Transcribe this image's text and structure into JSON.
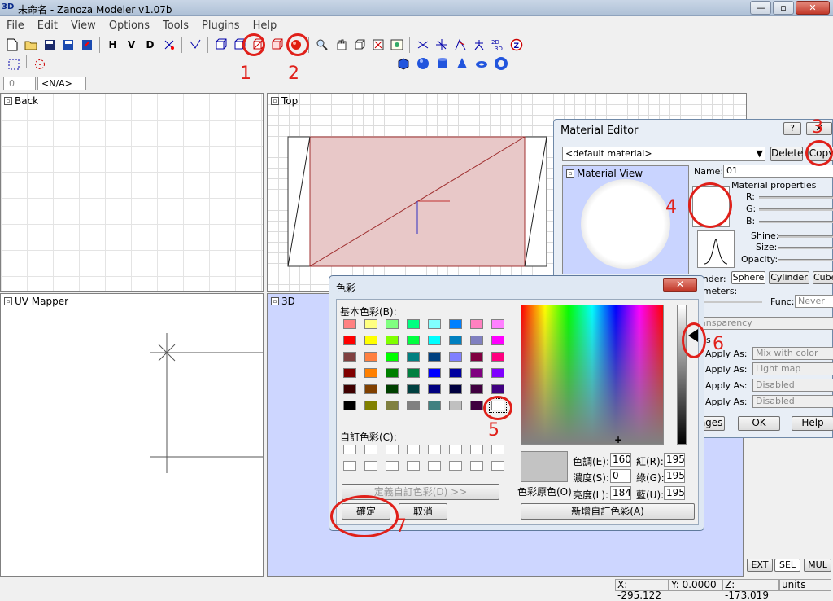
{
  "window": {
    "app_icon": "3D",
    "title": "未命名 - Zanoza Modeler v1.07b",
    "minimize": "—",
    "maximize": "▫",
    "close": "✕"
  },
  "menu": [
    "File",
    "Edit",
    "View",
    "Options",
    "Tools",
    "Plugins",
    "Help"
  ],
  "toolbar": {
    "h_label": "H",
    "v_label": "V",
    "d_label": "D"
  },
  "frame": {
    "value": "0",
    "na": "<N/A>"
  },
  "viewports": {
    "back": "Back",
    "top": "Top",
    "uv": "UV Mapper",
    "three_d": "3D"
  },
  "annotations": [
    "1",
    "2",
    "3",
    "4",
    "5",
    "6",
    "7"
  ],
  "material_editor": {
    "title": "Material Editor",
    "help": "?",
    "close": "✕",
    "material_select": "<default material>",
    "delete": "Delete",
    "copy": "Copy",
    "view_label": "Material View",
    "name_label": "Name:",
    "name_value": "01",
    "props_label": "Material properties",
    "r": "R:",
    "g": "G:",
    "b": "B:",
    "shine": "Shine:",
    "size": "Size:",
    "opacity": "Opacity:",
    "render_label": "ender:",
    "sphere": "Sphere",
    "cylinder": "Cylinder",
    "cube": "Cube",
    "parameters": "ameters:",
    "func": "Func:",
    "func_value": "Never",
    "transparency": "ansparency",
    "textures": "res",
    "apply_as": "Apply As:",
    "apply_values": [
      "Mix with color",
      "Light map",
      "Disabled",
      "Disabled"
    ],
    "changes": "nges",
    "ok": "OK",
    "help_btn": "Help"
  },
  "color_dialog": {
    "title": "色彩",
    "close": "✕",
    "basic_colors": "基本色彩(B):",
    "custom_colors": "自訂色彩(C):",
    "define_custom": "定義自訂色彩(D) >>",
    "ok": "確定",
    "cancel": "取消",
    "solid": "色彩原色(O)",
    "hue": "色調(E):",
    "hue_v": "160",
    "sat": "濃度(S):",
    "sat_v": "0",
    "lum": "亮度(L):",
    "lum_v": "184",
    "red": "紅(R):",
    "red_v": "195",
    "green": "綠(G):",
    "green_v": "195",
    "blue": "藍(U):",
    "blue_v": "195",
    "add_custom": "新增自訂色彩(A)",
    "swatches": [
      "#ff8080",
      "#ffff80",
      "#80ff80",
      "#00ff80",
      "#80ffff",
      "#0080ff",
      "#ff80c0",
      "#ff80ff",
      "#ff0000",
      "#ffff00",
      "#80ff00",
      "#00ff40",
      "#00ffff",
      "#0080c0",
      "#8080c0",
      "#ff00ff",
      "#804040",
      "#ff8040",
      "#00ff00",
      "#008080",
      "#004080",
      "#8080ff",
      "#800040",
      "#ff0080",
      "#800000",
      "#ff8000",
      "#008000",
      "#008040",
      "#0000ff",
      "#0000a0",
      "#800080",
      "#8000ff",
      "#400000",
      "#804000",
      "#004000",
      "#004040",
      "#000080",
      "#000040",
      "#400040",
      "#400080",
      "#000000",
      "#808000",
      "#808040",
      "#808080",
      "#408080",
      "#c0c0c0",
      "#400040",
      "#ffffff"
    ]
  },
  "buttons_right": {
    "ext": "EXT",
    "sel": "SEL",
    "mul": "MUL"
  },
  "status": {
    "x": "X: -295.122",
    "y": "Y: 0.0000",
    "z": "Z: -173.019",
    "units": "units"
  }
}
